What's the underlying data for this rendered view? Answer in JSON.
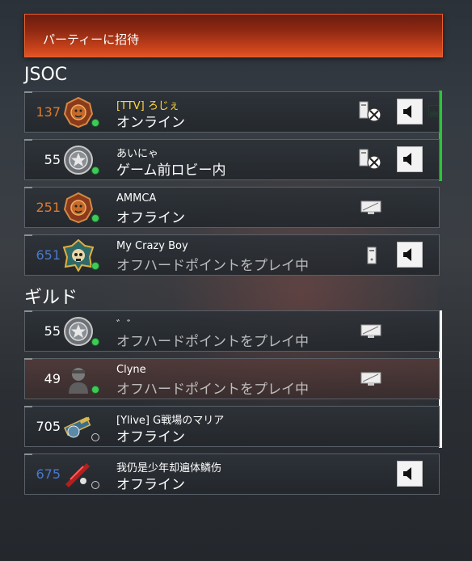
{
  "invite": {
    "label": "パーティーに招待"
  },
  "sections": {
    "jsoc": "JSOC",
    "guild": "ギルド"
  },
  "colors": {
    "accent": "#e2552a",
    "online": "#3ecb55",
    "party": "#2fc23a",
    "tag": "#ffd83a",
    "level_orange": "#e07a2a",
    "level_blue": "#4a78c8"
  },
  "rows": [
    {
      "level": "137",
      "level_color": "orange",
      "emblem": "lion-crest-emblem",
      "tag": "[TTV]",
      "name": "ろじぇ",
      "status": "オンライン",
      "presence": "online",
      "platform": "xbox-pc-icon",
      "speaker": true
    },
    {
      "level": "55",
      "level_color": "white",
      "emblem": "silver-star-emblem",
      "tag": "",
      "name": "あいにゃ",
      "status": "ゲーム前ロビー内",
      "presence": "online",
      "platform": "xbox-pc-icon",
      "speaker": true
    },
    {
      "level": "251",
      "level_color": "orange",
      "emblem": "lion-crest-emblem",
      "tag": "",
      "name": "AMMCA",
      "status": "オフライン",
      "presence": "online",
      "platform": "monitor-icon",
      "speaker": false
    },
    {
      "level": "651",
      "level_color": "blue",
      "emblem": "gold-skull-emblem",
      "tag": "",
      "name": "My Crazy Boy",
      "status": "オフハードポイントをプレイ中",
      "presence": "online",
      "platform": "tower-icon",
      "speaker": true
    },
    {
      "level": "55",
      "level_color": "white",
      "emblem": "silver-star-emblem",
      "tag": "",
      "name": "゛゛",
      "status": "オフハードポイントをプレイ中",
      "presence": "online",
      "platform": "monitor-icon",
      "speaker": false
    },
    {
      "level": "49",
      "level_color": "white",
      "emblem": "soldier-emblem",
      "tag": "",
      "name": "Clyne",
      "status": "オフハードポイントをプレイ中",
      "presence": "online",
      "platform": "monitor-icon",
      "speaker": false
    },
    {
      "level": "705",
      "level_color": "white",
      "emblem": "gunner-emblem",
      "tag": "",
      "name": "[Ylive] G戦場のマリア",
      "status": "オフライン",
      "presence": "offline",
      "platform": "",
      "speaker": false
    },
    {
      "level": "675",
      "level_color": "blue",
      "emblem": "red-slash-emblem",
      "tag": "",
      "name": "我仍是少年却遍体鳞伤",
      "status": "オフライン",
      "presence": "offline",
      "platform": "",
      "speaker": true
    }
  ]
}
